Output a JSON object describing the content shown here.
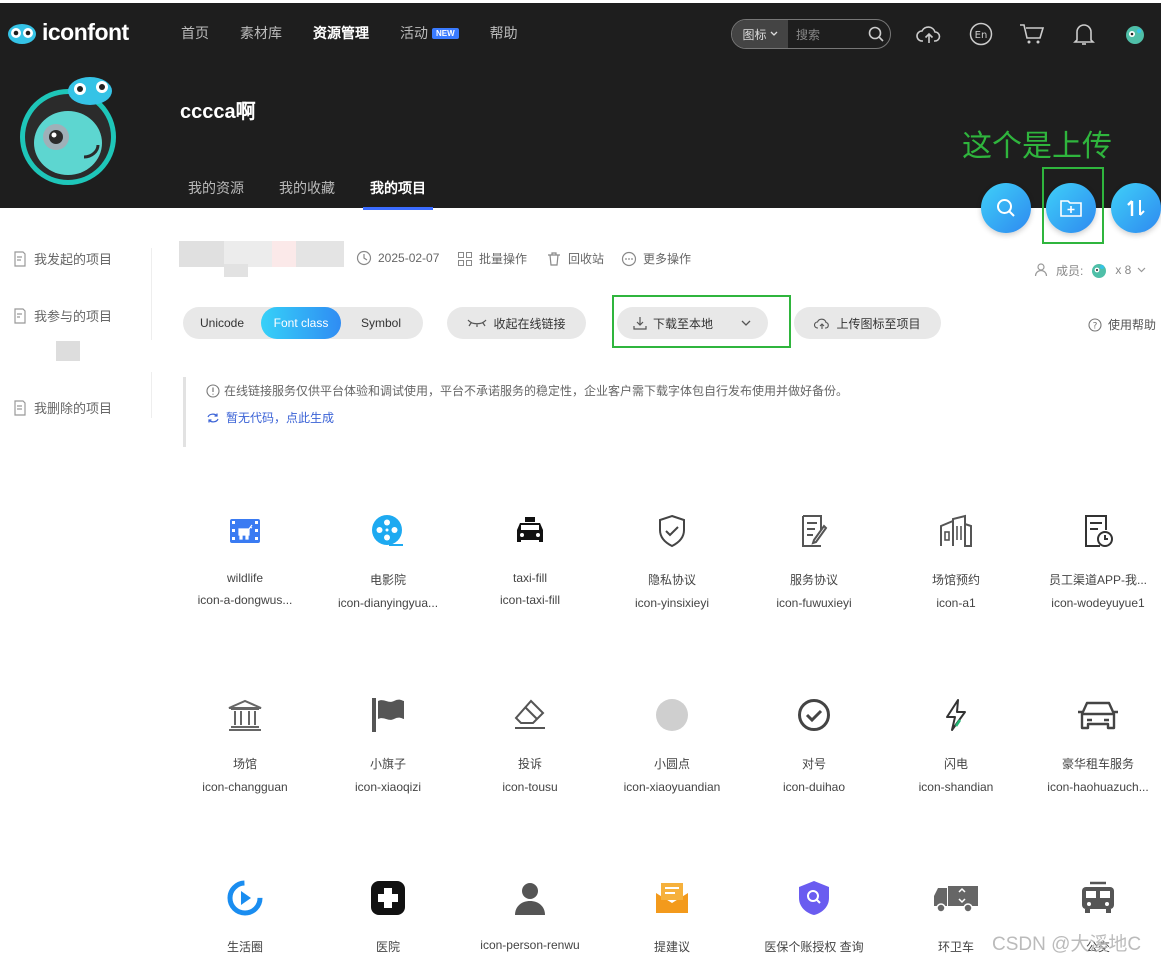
{
  "header": {
    "logo_text": "iconfont",
    "nav": [
      {
        "label": "首页",
        "active": false
      },
      {
        "label": "素材库",
        "active": false
      },
      {
        "label": "资源管理",
        "active": true
      },
      {
        "label": "活动",
        "active": false,
        "badge": "NEW"
      },
      {
        "label": "帮助",
        "active": false
      }
    ],
    "search": {
      "category": "图标",
      "placeholder": "搜索"
    }
  },
  "profile": {
    "username": "cccca啊",
    "tabs": [
      {
        "label": "我的资源",
        "active": false
      },
      {
        "label": "我的收藏",
        "active": false
      },
      {
        "label": "我的项目",
        "active": true
      }
    ]
  },
  "annotation": {
    "upload_note": "这个是上传",
    "color": "#2fb53d"
  },
  "sidebar": {
    "items": [
      {
        "label": "我发起的项目"
      },
      {
        "label": "我参与的项目"
      },
      {
        "label": "我删除的项目"
      }
    ]
  },
  "project": {
    "date": "2025-02-07",
    "batch": "批量操作",
    "recycle": "回收站",
    "more": "更多操作",
    "members_label": "成员:",
    "members_count": "x 8"
  },
  "toolbar": {
    "modes": [
      {
        "label": "Unicode",
        "active": false
      },
      {
        "label": "Font class",
        "active": true
      },
      {
        "label": "Symbol",
        "active": false
      }
    ],
    "collapse_link": "收起在线链接",
    "download": "下载至本地",
    "upload": "上传图标至项目",
    "help": "使用帮助"
  },
  "notice": {
    "text": "在线链接服务仅供平台体验和调试使用，平台不承诺服务的稳定性，企业客户需下载字体包自行发布使用并做好备份。",
    "link": "暂无代码，点此生成"
  },
  "icons": [
    {
      "name": "wildlife",
      "class": "icon-a-dongwus...",
      "glyph": "deer-icon"
    },
    {
      "name": "电影院",
      "class": "icon-dianyingyua...",
      "glyph": "film-reel-icon"
    },
    {
      "name": "taxi-fill",
      "class": "icon-taxi-fill",
      "glyph": "taxi-icon"
    },
    {
      "name": "隐私协议",
      "class": "icon-yinsixieyi",
      "glyph": "shield-check-icon"
    },
    {
      "name": "服务协议",
      "class": "icon-fuwuxieyi",
      "glyph": "document-edit-icon"
    },
    {
      "name": "场馆预约",
      "class": "icon-a1",
      "glyph": "building-icon"
    },
    {
      "name": "员工渠道APP-我...",
      "class": "icon-wodeyuyue1",
      "glyph": "document-clock-icon"
    },
    {
      "name": "场馆",
      "class": "icon-changguan",
      "glyph": "museum-icon"
    },
    {
      "name": "小旗子",
      "class": "icon-xiaoqizi",
      "glyph": "flag-icon"
    },
    {
      "name": "投诉",
      "class": "icon-tousu",
      "glyph": "eraser-icon"
    },
    {
      "name": "小圆点",
      "class": "icon-xiaoyuandian",
      "glyph": "dot-icon"
    },
    {
      "name": "对号",
      "class": "icon-duihao",
      "glyph": "check-circle-icon"
    },
    {
      "name": "闪电",
      "class": "icon-shandian",
      "glyph": "lightning-icon"
    },
    {
      "name": "豪华租车服务",
      "class": "icon-haohuazuch...",
      "glyph": "car-icon"
    },
    {
      "name": "生活圈",
      "class": "",
      "glyph": "play-circle-icon"
    },
    {
      "name": "医院",
      "class": "",
      "glyph": "hospital-cross-icon"
    },
    {
      "name": "icon-person-renwu",
      "class": "",
      "glyph": "person-icon"
    },
    {
      "name": "提建议",
      "class": "",
      "glyph": "mail-suggest-icon"
    },
    {
      "name": "医保个账授权 查询",
      "class": "",
      "glyph": "shield-search-icon"
    },
    {
      "name": "环卫车",
      "class": "",
      "glyph": "garbage-truck-icon"
    },
    {
      "name": "公交",
      "class": "",
      "glyph": "bus-icon"
    }
  ],
  "watermark": "CSDN @大溪地C"
}
